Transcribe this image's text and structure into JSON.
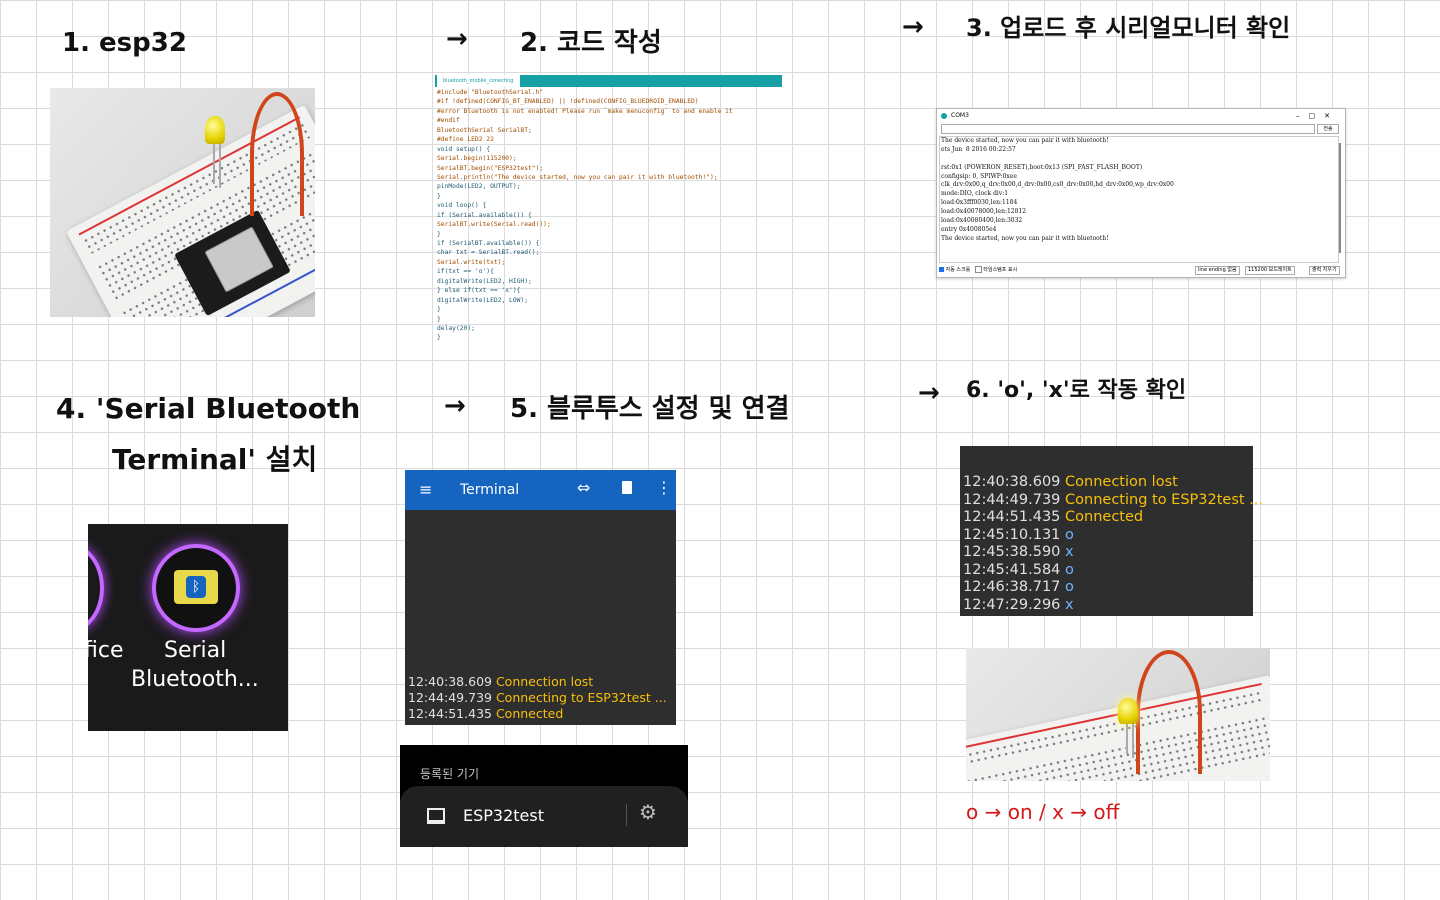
{
  "steps": {
    "s1": "1. esp32",
    "s2_arrow": "→",
    "s2": "2.  코드 작성",
    "s3_arrow": "→",
    "s3": "3.  업로드 후  시리얼모니터 확인",
    "s4_line1": "4. 'Serial Bluetooth",
    "s4_line2": "Terminal' 설치",
    "s5_arrow": "→",
    "s5": "5. 블루투스  설정 및  연결",
    "s6_arrow": "→",
    "s6": "6. 'o', 'x'로  작동 확인"
  },
  "code": {
    "tab_label": "bluetooth_mobile_conecting",
    "lines": [
      "#include \"BluetoothSerial.h\"",
      "#if !defined(CONFIG_BT_ENABLED) || !defined(CONFIG_BLUEDROID_ENABLED)",
      "#error Bluetooth is not enabled! Please run `make menuconfig` to and enable it",
      "#endif",
      "BluetoothSerial SerialBT;",
      "#define LED2 22",
      "void setup() {",
      "Serial.begin(115200);",
      "SerialBT.begin(\"ESP32test\");",
      "Serial.println(\"The device started, now you can pair it with bluetooth!\");",
      "pinMode(LED2, OUTPUT);",
      "}",
      "void loop() {",
      "if (Serial.available()) {",
      "SerialBT.write(Serial.read());",
      "}",
      "if (SerialBT.available()) {",
      "char txt = SerialBT.read();",
      "Serial.write(txt);",
      "if(txt == 'o'){",
      "digitalWrite(LED2, HIGH);",
      "} else if(txt == 'x'){",
      "digitalWrite(LED2, LOW);",
      "}",
      "}",
      "delay(20);",
      "}"
    ]
  },
  "monitor": {
    "title": "COM3",
    "send": "전송",
    "lines": [
      "The device started, now you can pair it with bluetooth!",
      "ets Jun  8 2016 00:22:57",
      "",
      "rst:0x1 (POWERON_RESET),boot:0x13 (SPI_FAST_FLASH_BOOT)",
      "configsip: 0, SPIWP:0xee",
      "clk_drv:0x00,q_drv:0x00,d_drv:0x00,cs0_drv:0x00,hd_drv:0x00,wp_drv:0x00",
      "mode:DIO, clock div:1",
      "load:0x3fff0030,len:1184",
      "load:0x40078000,len:12812",
      "load:0x40080400,len:3032",
      "entry 0x400805e4",
      "The device started, now you can pair it with bluetooth!"
    ],
    "autoscroll": "자동 스크롤",
    "timestamp": "타임스탬프 표시",
    "line_ending": "line ending 없음",
    "baud": "115200 보드레이트",
    "clear": "출력 지우기"
  },
  "app_tile": {
    "left_partial": "fice",
    "name_line1": "Serial",
    "name_line2": "Bluetooth..."
  },
  "terminal": {
    "title": "Terminal",
    "log": [
      {
        "time": "12:40:38.609",
        "msg": "Connection lost"
      },
      {
        "time": "12:44:49.739",
        "msg": "Connecting to ESP32test ..."
      },
      {
        "time": "12:44:51.435",
        "msg": "Connected"
      }
    ]
  },
  "devices": {
    "heading": "등록된 기기",
    "device_name": "ESP32test"
  },
  "result_log": [
    {
      "time": "12:40:38.609",
      "msg": "Connection lost",
      "kind": "status"
    },
    {
      "time": "12:44:49.739",
      "msg": "Connecting to ESP32test ...",
      "kind": "status"
    },
    {
      "time": "12:44:51.435",
      "msg": "Connected",
      "kind": "status"
    },
    {
      "time": "12:45:10.131",
      "msg": "o",
      "kind": "cmd"
    },
    {
      "time": "12:45:38.590",
      "msg": "x",
      "kind": "cmd"
    },
    {
      "time": "12:45:41.584",
      "msg": "o",
      "kind": "cmd"
    },
    {
      "time": "12:46:38.717",
      "msg": "o",
      "kind": "cmd"
    },
    {
      "time": "12:47:29.296",
      "msg": "x",
      "kind": "cmd"
    }
  ],
  "note": "o → on  /  x → off",
  "colors": {
    "terminal_header": "#1565c0",
    "accent_yellow": "#f6c00a",
    "accent_blue": "#6fb5ff",
    "note_red": "#d21919"
  }
}
